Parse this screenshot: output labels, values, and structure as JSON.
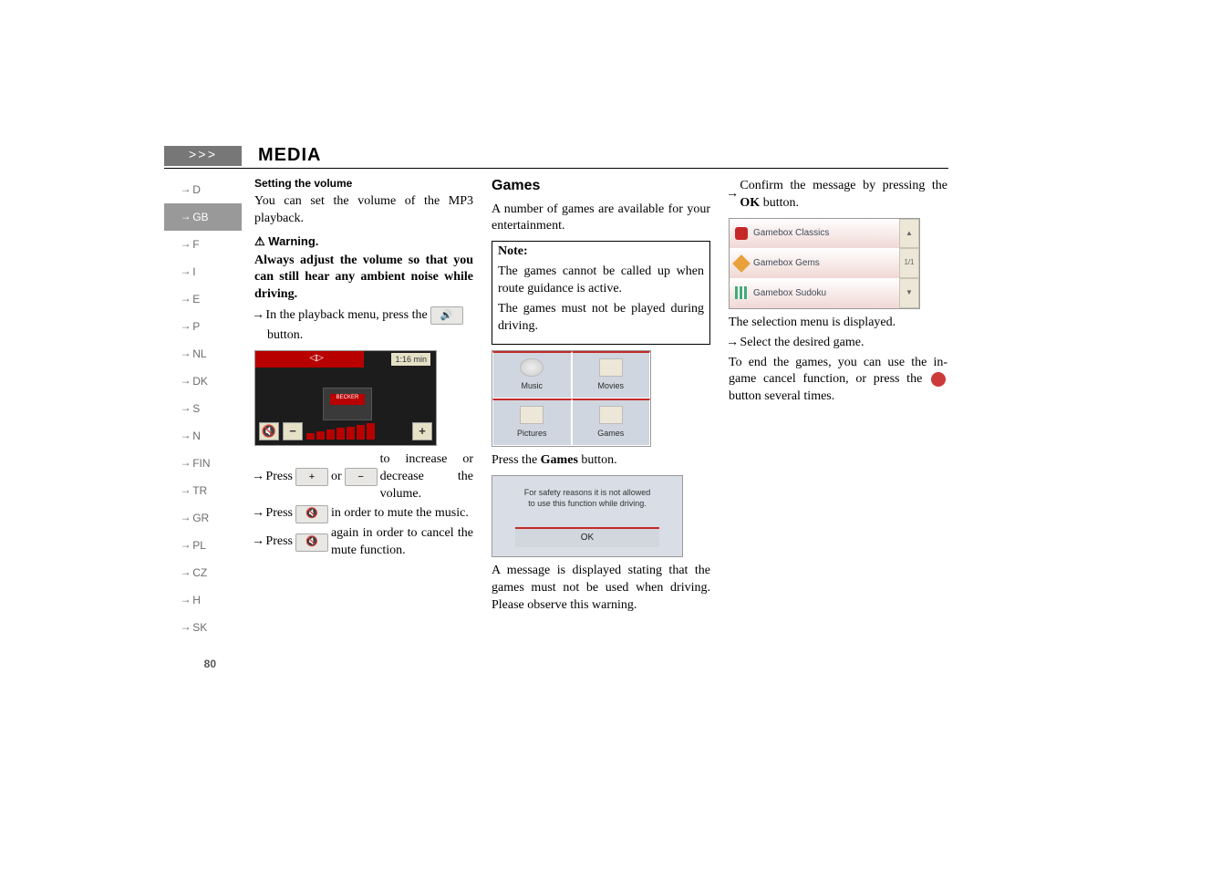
{
  "header": {
    "arrows": ">>>",
    "title": "MEDIA"
  },
  "sidebar": {
    "items": [
      {
        "label": "D",
        "active": false
      },
      {
        "label": "GB",
        "active": true
      },
      {
        "label": "F",
        "active": false
      },
      {
        "label": "I",
        "active": false
      },
      {
        "label": "E",
        "active": false
      },
      {
        "label": "P",
        "active": false
      },
      {
        "label": "NL",
        "active": false
      },
      {
        "label": "DK",
        "active": false
      },
      {
        "label": "S",
        "active": false
      },
      {
        "label": "N",
        "active": false
      },
      {
        "label": "FIN",
        "active": false
      },
      {
        "label": "TR",
        "active": false
      },
      {
        "label": "GR",
        "active": false
      },
      {
        "label": "PL",
        "active": false
      },
      {
        "label": "CZ",
        "active": false
      },
      {
        "label": "H",
        "active": false
      },
      {
        "label": "SK",
        "active": false
      }
    ],
    "page_number": "80"
  },
  "col1": {
    "sec_title": "Setting the volume",
    "p1": "You can set the volume of the MP3 playback.",
    "warn_icon": "!",
    "warn_title": "Warning.",
    "warn_body": "Always adjust the volume so that you can still hear any ambient noise while driving.",
    "step1_a": "In the playback menu, press the",
    "step1_b": "button.",
    "vol_shot": {
      "time": "1:16 min",
      "decker": "BECKER",
      "mute": "🔇",
      "minus": "−",
      "plus": "+"
    },
    "step2_a": "Press",
    "step2_plus": "+",
    "step2_or": "or",
    "step2_minus": "−",
    "step2_b": "to increase or decrease the volume.",
    "step3_a": "Press",
    "step3_mute": "🔇",
    "step3_b": "in order to mute the music.",
    "step4_a": "Press",
    "step4_mute": "🔇",
    "step4_b": "again in order to cancel the mute function."
  },
  "col2": {
    "title": "Games",
    "p1": "A number of games are available for your entertainment.",
    "note_title": "Note:",
    "note_p1": "The games cannot be called up when route guidance is active.",
    "note_p2": "The games must not be played during driving.",
    "menu": {
      "music": "Music",
      "movies": "Movies",
      "pictures": "Pictures",
      "games": "Games"
    },
    "press_a": "Press the ",
    "press_b": "Games",
    "press_c": " button.",
    "safety_msg1": "For safety reasons it is not allowed",
    "safety_msg2": "to use this function while driving.",
    "ok": "OK",
    "p2": "A message is displayed stating that the games must not be used when driving. Please observe this warning."
  },
  "col3": {
    "step1_a": "Confirm the message by pressing the",
    "step1_b": "OK",
    "step1_c": "button.",
    "games": {
      "g1": "Gamebox Classics",
      "g2": "Gamebox Gems",
      "g3": "Gamebox Sudoku",
      "scroll_up": "▲",
      "scroll_mid": "1/1",
      "scroll_down": "▼"
    },
    "p1": "The selection menu is displayed.",
    "step2": "Select the desired game.",
    "p2a": "To end the games, you can use the in-game cancel function, or press the",
    "p2b": "button several times."
  }
}
